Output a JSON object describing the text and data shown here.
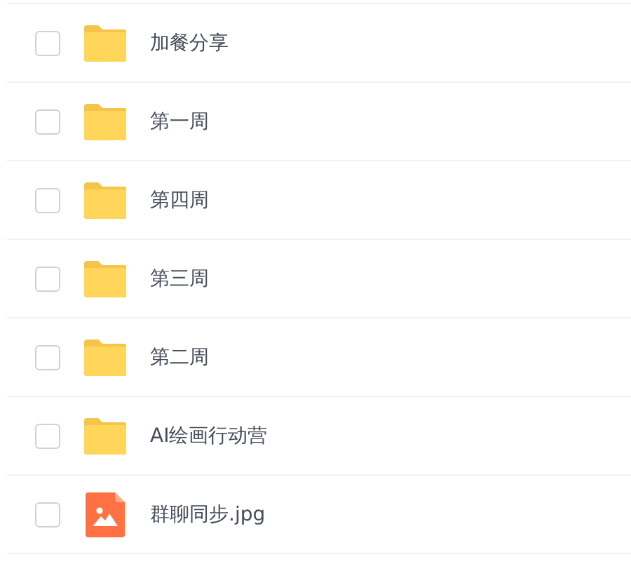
{
  "files": [
    {
      "name": "加餐分享",
      "kind": "folder",
      "checked": false
    },
    {
      "name": "第一周",
      "kind": "folder",
      "checked": false
    },
    {
      "name": "第四周",
      "kind": "folder",
      "checked": false
    },
    {
      "name": "第三周",
      "kind": "folder",
      "checked": false
    },
    {
      "name": "第二周",
      "kind": "folder",
      "checked": false
    },
    {
      "name": "AI绘画行动营",
      "kind": "folder",
      "checked": false
    },
    {
      "name": "群聊同步.jpg",
      "kind": "image",
      "checked": false
    }
  ]
}
